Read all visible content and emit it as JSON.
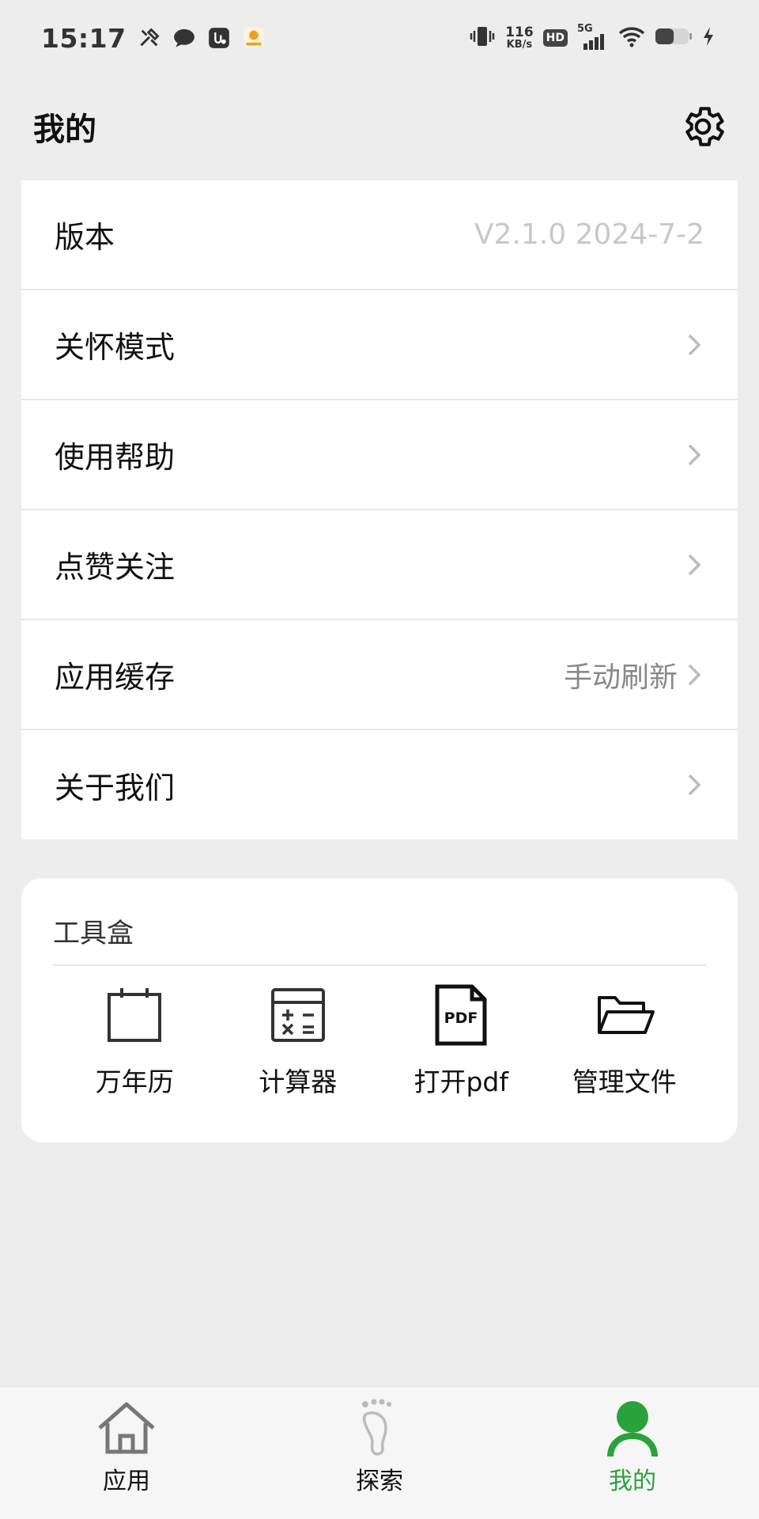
{
  "status_bar": {
    "time": "15:17",
    "network_speed_value": "116",
    "network_speed_unit": "KB/s",
    "hd_label": "HD",
    "network_type": "5G",
    "battery_level_fraction": 0.55,
    "icons": [
      "tools-icon",
      "chat-icon",
      "usb-debug-icon",
      "app-notification-icon",
      "vibrate-icon",
      "wifi-icon",
      "battery-icon",
      "charging-icon"
    ]
  },
  "header": {
    "title": "我的",
    "settings_icon": "gear-icon"
  },
  "menu": {
    "items": [
      {
        "label": "版本",
        "value": "V2.1.0 2024-7-2",
        "has_chevron": false
      },
      {
        "label": "关怀模式",
        "value": "",
        "has_chevron": true
      },
      {
        "label": "使用帮助",
        "value": "",
        "has_chevron": true
      },
      {
        "label": "点赞关注",
        "value": "",
        "has_chevron": true
      },
      {
        "label": "应用缓存",
        "value": "手动刷新",
        "has_chevron": true
      },
      {
        "label": "关于我们",
        "value": "",
        "has_chevron": true
      }
    ]
  },
  "toolbox": {
    "title": "工具盒",
    "tools": [
      {
        "label": "万年历",
        "icon": "calendar-icon"
      },
      {
        "label": "计算器",
        "icon": "calculator-icon"
      },
      {
        "label": "打开pdf",
        "icon": "pdf-icon",
        "icon_text": "PDF"
      },
      {
        "label": "管理文件",
        "icon": "folder-icon"
      }
    ]
  },
  "bottom_nav": {
    "tabs": [
      {
        "label": "应用",
        "icon": "home-icon",
        "active": false
      },
      {
        "label": "探索",
        "icon": "footprint-icon",
        "active": false
      },
      {
        "label": "我的",
        "icon": "user-icon",
        "active": true
      }
    ],
    "active_color": "#2aa23c"
  }
}
